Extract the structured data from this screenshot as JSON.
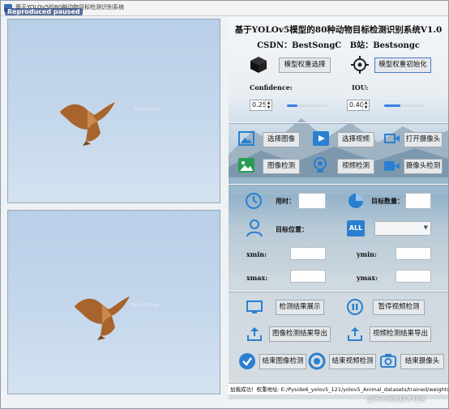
{
  "window": {
    "title": "基于YOLOv5的80种动物目标检测识别系统",
    "overlay_label": "Reproduced paused"
  },
  "previews": {
    "top_label": "bird 0.93 kite",
    "bottom_label": "bird 0.93 kite"
  },
  "header": {
    "title": "基于YOLOv5模型的80种动物目标检测识别系统V1.0",
    "csdn_label": "CSDN：",
    "csdn_value": "BestSongC",
    "bili_label": "B站：",
    "bili_value": "Bestsongc"
  },
  "model": {
    "select_button": "模型权重选择",
    "init_button": "模型权重初始化"
  },
  "params": {
    "confidence_label": "Confidence:",
    "confidence_value": "0.25",
    "confidence_fraction": 0.25,
    "iou_label": "IOU:",
    "iou_value": "0.40",
    "iou_fraction": 0.4
  },
  "actions": {
    "select_image": "选择图像",
    "select_video": "选择视频",
    "open_camera": "打开摄像头",
    "image_detect": "图像检测",
    "video_detect": "视频检测",
    "camera_detect": "摄像头检测"
  },
  "results": {
    "time_label": "用时：",
    "count_label": "目标数量：",
    "position_label": "目标位置：",
    "xmin_label": "xmin:",
    "ymin_label": "ymin:",
    "xmax_label": "xmax:",
    "ymax_label": "ymax:",
    "all_icon_text": "ALL"
  },
  "output": {
    "show_results": "检测结果展示",
    "pause_video": "暂停视频检测",
    "export_image": "图像检测结果导出",
    "export_video": "视频检测结果导出",
    "end_image": "结束图像检测",
    "end_video": "结束视频检测",
    "end_camera": "结束摄像头"
  },
  "status": {
    "text": "加载成功！权重地址: E:/Pyside6_yolov5_121/yolov5_Animal_datasets/trained/weights/best.pt"
  },
  "watermark": "@稀土掘金技术社区",
  "colors": {
    "accent": "#3c7de6",
    "button_border": "#4b78c8"
  }
}
